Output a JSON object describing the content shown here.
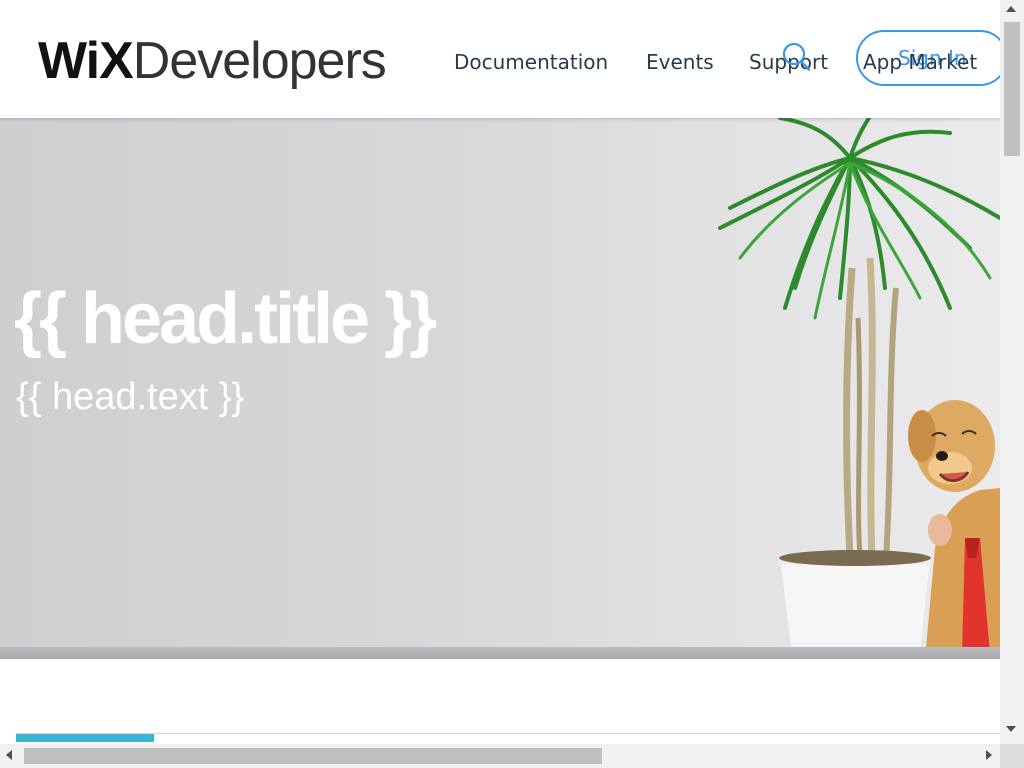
{
  "header": {
    "logo": {
      "wordmark": "WiX",
      "suffix": "Developers"
    },
    "nav": [
      {
        "label": "Documentation",
        "name": "nav-documentation"
      },
      {
        "label": "Events",
        "name": "nav-events"
      },
      {
        "label": "Support",
        "name": "nav-support"
      },
      {
        "label": "App Market",
        "name": "nav-app-market"
      }
    ],
    "search_icon": "search-icon",
    "signin_label": "Sign In",
    "accent_color": "#3899ec"
  },
  "hero": {
    "title": "{{ head.title }}",
    "text": "{{ head.text }}",
    "illustration": "plant-and-dog-photo"
  },
  "content": {
    "progress_percent": 14,
    "progress_color": "#3cb4d3"
  }
}
